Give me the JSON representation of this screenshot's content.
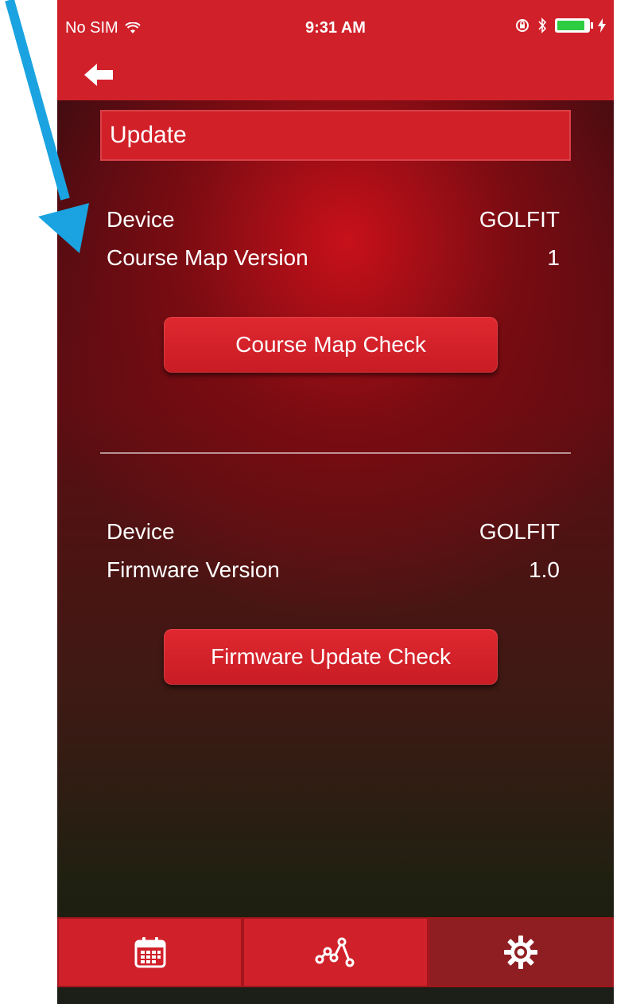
{
  "status_bar": {
    "carrier": "No SIM",
    "time": "9:31 AM",
    "battery_level": 0.9
  },
  "nav": {
    "back_icon": "back-arrow-icon"
  },
  "section": {
    "title": "Update"
  },
  "course_map": {
    "device_label": "Device",
    "device_value": "GOLFIT",
    "version_label": "Course Map Version",
    "version_value": "1",
    "button_label": "Course Map Check"
  },
  "firmware": {
    "device_label": "Device",
    "device_value": "GOLFIT",
    "version_label": "Firmware Version",
    "version_value": "1.0",
    "button_label": "Firmware Update Check"
  },
  "tabs": [
    {
      "icon": "calendar-icon",
      "selected": false
    },
    {
      "icon": "chart-line-icon",
      "selected": false
    },
    {
      "icon": "gear-icon",
      "selected": true
    }
  ],
  "colors": {
    "brand_red": "#d0212a",
    "selected_tab": "#8e1e22",
    "annotation_arrow": "#1aa3e0"
  }
}
